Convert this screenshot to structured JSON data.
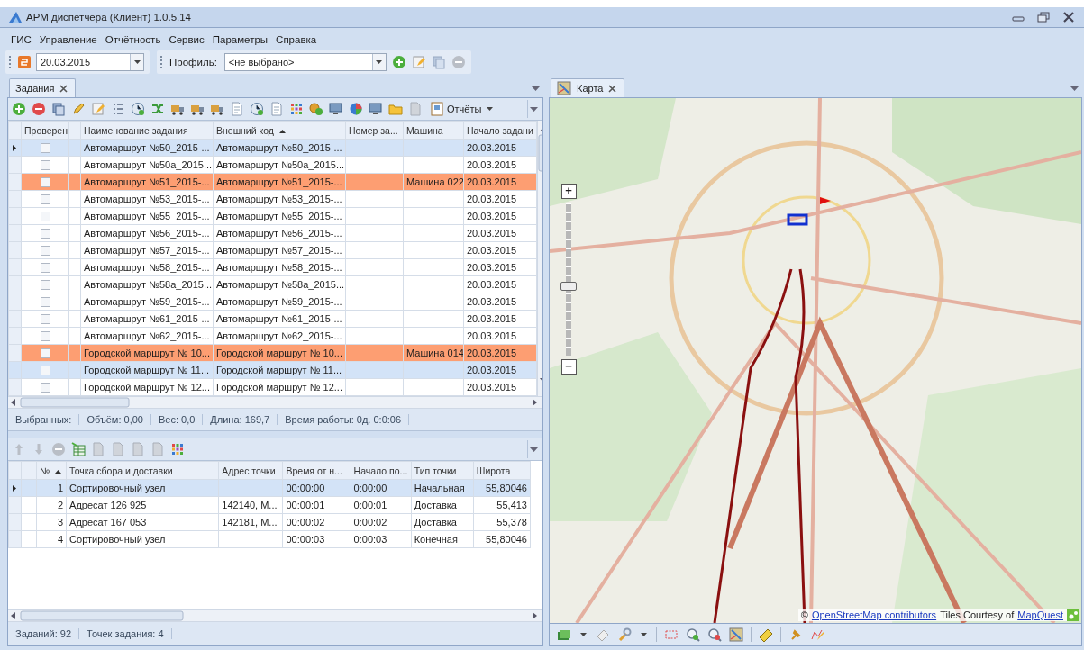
{
  "window": {
    "title": "АРМ диспетчера (Клиент) 1.0.5.14"
  },
  "menu": [
    "ГИС",
    "Управление",
    "Отчётность",
    "Сервис",
    "Параметры",
    "Справка"
  ],
  "date_field": {
    "value": "20.03.2015"
  },
  "profile": {
    "label": "Профиль:",
    "value": "<не выбрано>"
  },
  "left_tabs": [
    {
      "label": "Задания",
      "selected": true
    }
  ],
  "tasks_toolbar": {
    "reports_button": "Отчёты"
  },
  "tasks_table": {
    "columns": [
      {},
      {
        "label": "Проверен"
      },
      {},
      {
        "label": "Наименование задания"
      },
      {
        "label": "Внешний код",
        "sorted": true
      },
      {
        "label": "Номер за..."
      },
      {
        "label": "Машина"
      },
      {
        "label": "Начало задани"
      }
    ],
    "rows": [
      {
        "checked": false,
        "selected": true,
        "current": true,
        "color": "",
        "name": "Автомаршрут №50_2015-...",
        "code": "Автомаршрут №50_2015-...",
        "car": "",
        "start": "20.03.2015"
      },
      {
        "checked": false,
        "selected": false,
        "current": false,
        "color": "",
        "name": "Автомаршрут №50a_2015...",
        "code": "Автомаршрут №50a_2015...",
        "car": "",
        "start": "20.03.2015"
      },
      {
        "checked": false,
        "selected": false,
        "current": false,
        "color": "#fd9e72",
        "name": "Автомаршрут №51_2015-...",
        "code": "Автомаршрут №51_2015-...",
        "car": "Машина 022",
        "start": "20.03.2015"
      },
      {
        "checked": false,
        "selected": false,
        "current": false,
        "color": "",
        "name": "Автомаршрут №53_2015-...",
        "code": "Автомаршрут №53_2015-...",
        "car": "",
        "start": "20.03.2015"
      },
      {
        "checked": false,
        "selected": false,
        "current": false,
        "color": "",
        "name": "Автомаршрут №55_2015-...",
        "code": "Автомаршрут №55_2015-...",
        "car": "",
        "start": "20.03.2015"
      },
      {
        "checked": false,
        "selected": false,
        "current": false,
        "color": "",
        "name": "Автомаршрут №56_2015-...",
        "code": "Автомаршрут №56_2015-...",
        "car": "",
        "start": "20.03.2015"
      },
      {
        "checked": false,
        "selected": false,
        "current": false,
        "color": "",
        "name": "Автомаршрут №57_2015-...",
        "code": "Автомаршрут №57_2015-...",
        "car": "",
        "start": "20.03.2015"
      },
      {
        "checked": false,
        "selected": false,
        "current": false,
        "color": "",
        "name": "Автомаршрут №58_2015-...",
        "code": "Автомаршрут №58_2015-...",
        "car": "",
        "start": "20.03.2015"
      },
      {
        "checked": false,
        "selected": false,
        "current": false,
        "color": "",
        "name": "Автомаршрут №58a_2015...",
        "code": "Автомаршрут №58a_2015...",
        "car": "",
        "start": "20.03.2015"
      },
      {
        "checked": false,
        "selected": false,
        "current": false,
        "color": "",
        "name": "Автомаршрут №59_2015-...",
        "code": "Автомаршрут №59_2015-...",
        "car": "",
        "start": "20.03.2015"
      },
      {
        "checked": false,
        "selected": false,
        "current": false,
        "color": "",
        "name": "Автомаршрут №61_2015-...",
        "code": "Автомаршрут №61_2015-...",
        "car": "",
        "start": "20.03.2015"
      },
      {
        "checked": false,
        "selected": false,
        "current": false,
        "color": "",
        "name": "Автомаршрут №62_2015-...",
        "code": "Автомаршрут №62_2015-...",
        "car": "",
        "start": "20.03.2015"
      },
      {
        "checked": false,
        "selected": false,
        "current": false,
        "color": "#fd9e72",
        "name": "Городской маршрут № 10...",
        "code": "Городской маршрут № 10...",
        "car": "Машина 014",
        "start": "20.03.2015"
      },
      {
        "checked": false,
        "selected": true,
        "current": false,
        "color": "",
        "name": "Городской маршрут № 11...",
        "code": "Городской маршрут № 11...",
        "car": "",
        "start": "20.03.2015"
      },
      {
        "checked": false,
        "selected": false,
        "current": false,
        "color": "",
        "name": "Городской маршрут № 12...",
        "code": "Городской маршрут № 12...",
        "car": "",
        "start": "20.03.2015"
      }
    ]
  },
  "summary": [
    "Выбранных:",
    "Объём: 0,00",
    "Вес: 0,0",
    "Длина: 169,7",
    "Время работы: 0д. 0:0:06"
  ],
  "points_table": {
    "columns": [
      {},
      {},
      {
        "label": "№",
        "sorted": true
      },
      {
        "label": "Точка сбора и доставки"
      },
      {
        "label": "Адрес точки"
      },
      {
        "label": "Время от н..."
      },
      {
        "label": "Начало по..."
      },
      {
        "label": "Тип точки"
      },
      {
        "label": "Широта"
      }
    ],
    "rows": [
      {
        "current": true,
        "number": "1",
        "point": "Сортировочный узел",
        "address": "",
        "time": "00:00:00",
        "begin": "0:00:00",
        "type": "Начальная",
        "lat": "55,80046"
      },
      {
        "current": false,
        "number": "2",
        "point": "Адресат 126 925",
        "address": "142140, М...",
        "time": "00:00:01",
        "begin": "0:00:01",
        "type": "Доставка",
        "lat": "55,413"
      },
      {
        "current": false,
        "number": "3",
        "point": "Адресат 167 053",
        "address": "142181, М...",
        "time": "00:00:02",
        "begin": "0:00:02",
        "type": "Доставка",
        "lat": "55,378"
      },
      {
        "current": false,
        "number": "4",
        "point": "Сортировочный узел",
        "address": "",
        "time": "00:00:03",
        "begin": "0:00:03",
        "type": "Конечная",
        "lat": "55,80046"
      }
    ]
  },
  "status_bar": [
    "Заданий: 92",
    "Точек задания: 4"
  ],
  "right_tabs": [
    {
      "label": "Карта",
      "selected": true
    }
  ],
  "map": {
    "zoom": {
      "level": 0.45
    },
    "zoom_in": "+",
    "zoom_out": "−",
    "attribution": {
      "copyright": "©",
      "osm_link": "OpenStreetMap contributors",
      "text": "Tiles Courtesy of",
      "mapquest_link": "MapQuest"
    }
  }
}
